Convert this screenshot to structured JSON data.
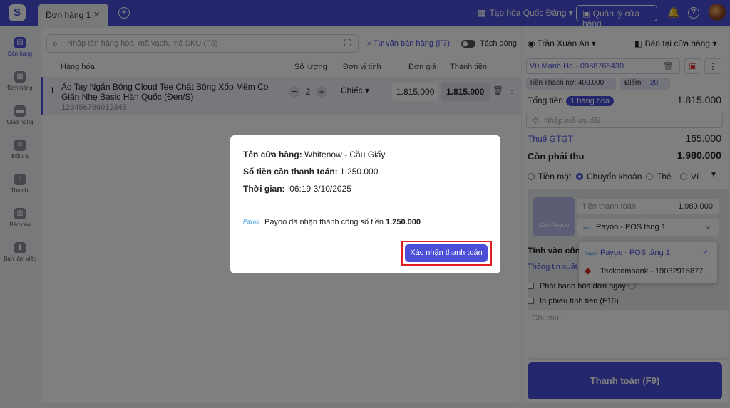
{
  "topbar": {
    "logo": "S",
    "tab_label": "Đơn hàng 1",
    "tab_close": "×",
    "add_tab": "+",
    "store": "Tạp hóa Quốc Đăng",
    "store_chevron": "▾",
    "manage": "Quản lý cửa hàng",
    "help": "?"
  },
  "sidebar": {
    "items": [
      {
        "label": "Bán hàng",
        "icon": "cart-icon",
        "glyph": "▤"
      },
      {
        "label": "Đơn hàng",
        "icon": "order-icon",
        "glyph": "▦"
      },
      {
        "label": "Giao hàng",
        "icon": "truck-icon",
        "glyph": "▬"
      },
      {
        "label": "Đổi trả",
        "icon": "return-icon",
        "glyph": "↺"
      },
      {
        "label": "Thu chi",
        "icon": "cash-icon",
        "glyph": "₫"
      },
      {
        "label": "Báo cáo",
        "icon": "report-icon",
        "glyph": "▥"
      },
      {
        "label": "Bàn làm việc",
        "icon": "desk-icon",
        "glyph": "▮"
      }
    ]
  },
  "main": {
    "search_placeholder": "Nhập tên hàng hóa, mã vạch, mã SKU (F3)",
    "advise": "Tư vấn bán hàng (F7)",
    "split": "Tách dòng",
    "columns": [
      "Hàng hóa",
      "Số lượng",
      "Đơn vị tính",
      "Đơn giá",
      "Thành tiền"
    ],
    "row": {
      "index": "1",
      "name": "Áo Tay Ngắn Bông Cloud Tee Chất Bông Xốp Mềm Co Giãn Nhẹ Basic Hàn Quốc (Đen/S)",
      "sku": "123456789012345",
      "qty": "2",
      "minus": "−",
      "plus": "+",
      "unit": "Chiếc",
      "unit_chevron": "▾",
      "price": "1.815.000",
      "total": "1.815.000",
      "more": "⋮"
    }
  },
  "right": {
    "staff": "Trần Xuân An",
    "channel": "Bán tại cửa hàng",
    "customer": "Vũ Mạnh Hà - 0988765439",
    "debt": "Tiền khách nợ: 400.000",
    "points_label": "Điểm:",
    "points_value": "20",
    "total_label": "Tổng tiền",
    "total_badge": "1 hàng hóa",
    "total_value": "1.815.000",
    "promo_placeholder": "Nhập mã ưu đãi",
    "vat_label": "Thuế GTGT",
    "vat_value": "165.000",
    "due_label": "Còn phải thu",
    "due_value": "1.980.000",
    "payment_methods": [
      "Tiền mặt",
      "Chuyển khoản",
      "Thẻ",
      "Ví"
    ],
    "selected_method": "Chuyển khoản",
    "payoo_button": "Gửi Payoo",
    "customer_pay_label": "Tiền thanh toán",
    "customer_pay_value": "1.980.000",
    "account": "Payoo - POS tầng 1",
    "account_logo": "Payoo",
    "einvoice_label": "Tính vào công",
    "info_link": "Thông tin xuất",
    "issue_now": "Phát hành hóa đơn ngay",
    "print_receipt": "In phiếu tính tiền (F10)",
    "note_placeholder": "Ghi chú...",
    "pay_button": "Thanh toán (F9)"
  },
  "dropdown": {
    "options": [
      {
        "label": "Payoo - POS tầng 1",
        "logo": "Payoo",
        "selected": true
      },
      {
        "label": "Teckcombank - 19032915877...",
        "logo": "TCB",
        "selected": false
      }
    ]
  },
  "modal": {
    "store_label": "Tên cửa hàng:",
    "store_value": "Whitenow - Cầu Giấy",
    "amount_label": "Số tiền cần thanh toán:",
    "amount_value": "1.250.000",
    "time_label": "Thời gian:",
    "time_value": "06:19 3/10/2025",
    "payoo_logo": "Payoo",
    "message": "Payoo đã nhận thành công số tiền",
    "message_amount": "1.250.000",
    "confirm": "Xác nhận thanh toán"
  },
  "colors": {
    "accent": "#4b4fd8",
    "highlight": "#e02020"
  }
}
